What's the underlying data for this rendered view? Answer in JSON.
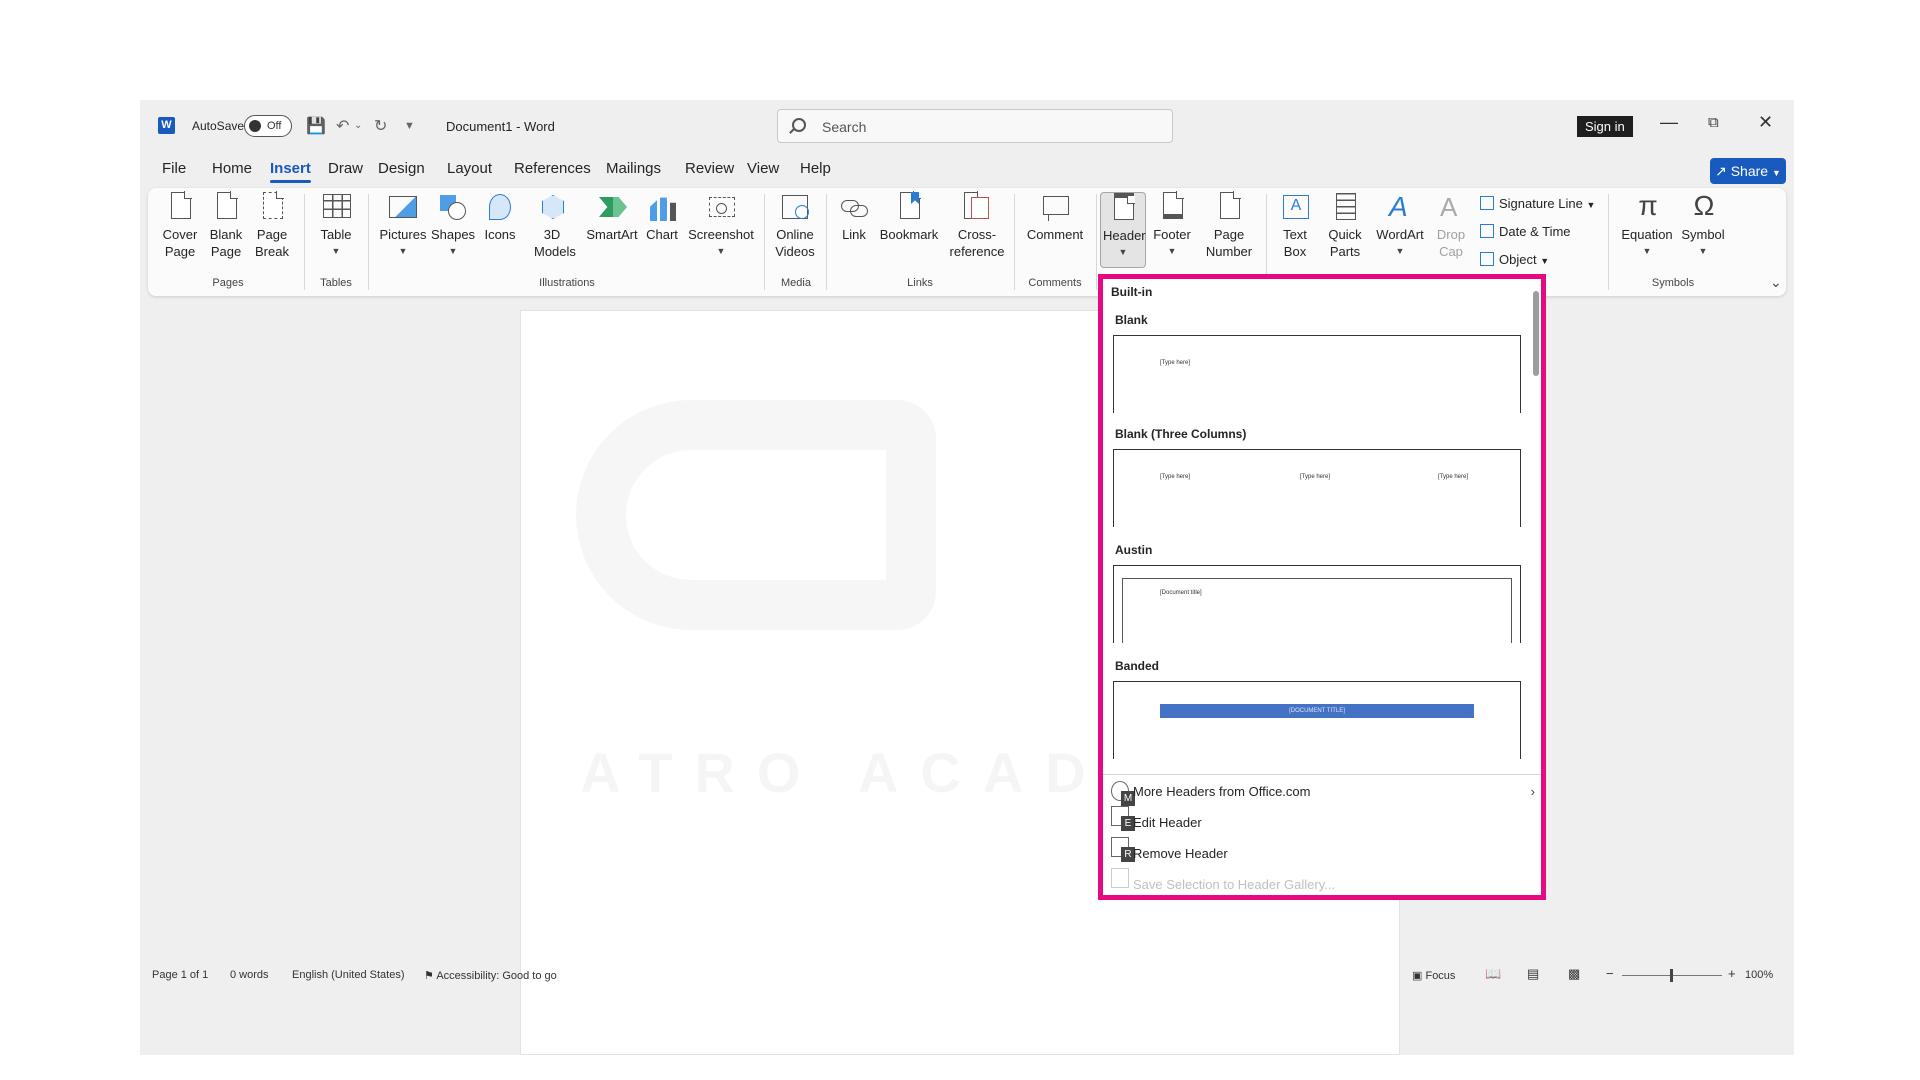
{
  "titlebar": {
    "logo": "W",
    "autosave_label": "AutoSave",
    "autosave_state": "Off",
    "doc_title": "Document1  -  Word",
    "search_placeholder": "Search",
    "signin_label": "Sign in",
    "icons": [
      "save-icon",
      "undo-icon",
      "redo-icon",
      "customize-qat-icon",
      "minimize-icon",
      "restore-icon",
      "close-icon"
    ]
  },
  "tabs": {
    "items": [
      "File",
      "Home",
      "Insert",
      "Draw",
      "Design",
      "Layout",
      "References",
      "Mailings",
      "Review",
      "View",
      "Help"
    ],
    "active": "Insert",
    "share_label": "Share"
  },
  "ribbon": {
    "buttons": {
      "cover_page": "Cover Page",
      "blank_page": "Blank Page",
      "page_break": "Page Break",
      "table": "Table",
      "pictures": "Pictures",
      "shapes": "Shapes",
      "icons": "Icons",
      "models_3d": "3D Models",
      "smartart": "SmartArt",
      "chart": "Chart",
      "screenshot": "Screenshot",
      "online_videos": "Online Videos",
      "link": "Link",
      "bookmark": "Bookmark",
      "cross_reference": "Cross-reference",
      "comment": "Comment",
      "header": "Header",
      "footer": "Footer",
      "page_number": "Page Number",
      "text_box": "Text Box",
      "quick_parts": "Quick Parts",
      "wordart": "WordArt",
      "drop_cap": "Drop Cap",
      "signature_line": "Signature Line",
      "date_time": "Date & Time",
      "object": "Object",
      "equation": "Equation",
      "symbol": "Symbol"
    },
    "groups": {
      "pages": "Pages",
      "tables": "Tables",
      "illustrations": "Illustrations",
      "media": "Media",
      "links": "Links",
      "comments": "Comments",
      "symbols": "Symbols"
    }
  },
  "gallery": {
    "section": "Built-in",
    "items": [
      {
        "name": "Blank",
        "placeholders": [
          "[Type here]"
        ]
      },
      {
        "name": "Blank (Three Columns)",
        "placeholders": [
          "[Type here]",
          "[Type here]",
          "[Type here]"
        ]
      },
      {
        "name": "Austin",
        "placeholders": [
          "[Document title]"
        ]
      },
      {
        "name": "Banded",
        "placeholders": [
          "[DOCUMENT TITLE]"
        ]
      }
    ],
    "menu": [
      {
        "label": "More Headers from Office.com",
        "key": "M",
        "enabled": true
      },
      {
        "label": "Edit Header",
        "key": "E",
        "enabled": true
      },
      {
        "label": "Remove Header",
        "key": "R",
        "enabled": true
      },
      {
        "label": "Save Selection to Header Gallery...",
        "key": "S",
        "enabled": false
      }
    ],
    "highlight_color": "#e6097f"
  },
  "watermark": {
    "text": "ATRO ACADEMY"
  },
  "statusbar": {
    "page": "Page 1 of 1",
    "words": "0 words",
    "language": "English (United States)",
    "accessibility": "Accessibility: Good to go",
    "focus": "Focus",
    "zoom": "100%"
  },
  "colors": {
    "accent": "#185abd",
    "highlight": "#e6097f"
  }
}
